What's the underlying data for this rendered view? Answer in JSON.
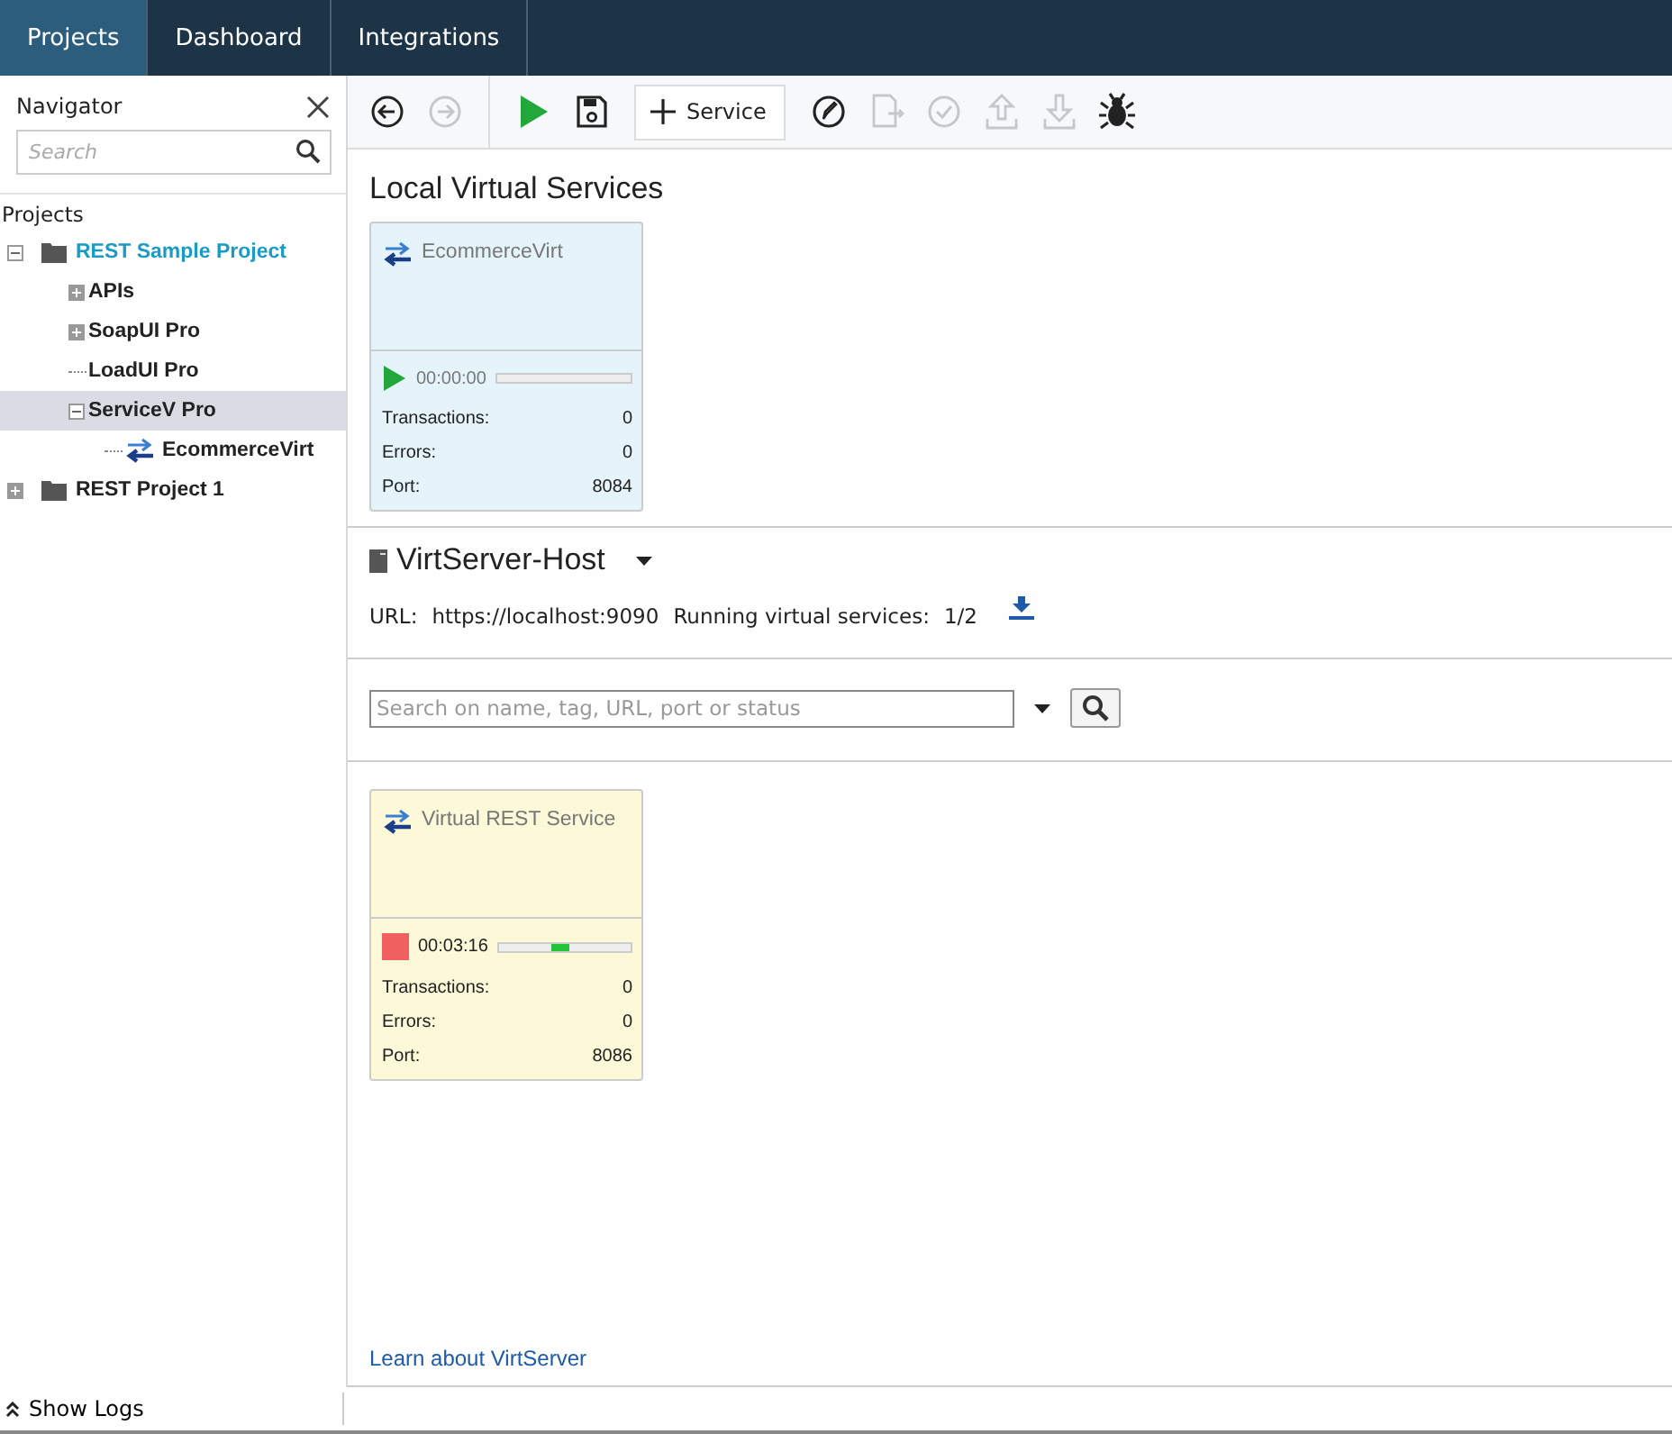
{
  "tabs": [
    {
      "label": "Projects",
      "selected": true
    },
    {
      "label": "Dashboard",
      "selected": false
    },
    {
      "label": "Integrations",
      "selected": false
    }
  ],
  "navigator": {
    "title": "Navigator",
    "search_placeholder": "Search",
    "section": "Projects",
    "tree": [
      {
        "label": "REST Sample Project",
        "kind": "project",
        "expanded": true,
        "active": true,
        "selected": false,
        "children": [
          {
            "label": "APIs",
            "expanded": false,
            "active": false,
            "selected": false
          },
          {
            "label": "SoapUI Pro",
            "expanded": false,
            "active": false,
            "selected": false
          },
          {
            "label": "LoadUI Pro",
            "active": false,
            "selected": false
          },
          {
            "label": "ServiceV Pro",
            "expanded": true,
            "active": false,
            "selected": true,
            "children": [
              {
                "label": "EcommerceVirt",
                "kind": "virt",
                "active": false,
                "selected": false
              }
            ]
          }
        ]
      },
      {
        "label": "REST Project 1",
        "kind": "project",
        "expanded": false,
        "active": false,
        "selected": false
      }
    ]
  },
  "toolbar": [
    {
      "kind": "back",
      "disabled": false
    },
    {
      "kind": "forward",
      "disabled": true
    },
    {
      "kind": "sep"
    },
    {
      "kind": "run",
      "disabled": false
    },
    {
      "kind": "save",
      "disabled": false
    },
    {
      "kind": "add",
      "label": "Service",
      "disabled": false
    },
    {
      "kind": "edit",
      "disabled": false
    },
    {
      "kind": "export",
      "disabled": true
    },
    {
      "kind": "check",
      "disabled": true
    },
    {
      "kind": "upload",
      "disabled": true
    },
    {
      "kind": "download",
      "disabled": true
    },
    {
      "kind": "bug",
      "disabled": false
    }
  ],
  "local": {
    "title": "Local Virtual Services",
    "cards": [
      {
        "name": "EcommerceVirt",
        "running": false,
        "time": "00:00:00",
        "stats": [
          {
            "label": "Transactions:",
            "value": "0"
          },
          {
            "label": "Errors:",
            "value": "0"
          },
          {
            "label": "Port:",
            "value": "8084"
          }
        ]
      }
    ]
  },
  "server": {
    "title": "VirtServer-Host",
    "url_label": "URL:",
    "url": "https://localhost:9090",
    "running_label": "Running virtual services:",
    "running": "1/2",
    "search_placeholder": "Search on name, tag, URL, port or status",
    "cards": [
      {
        "name": "Virtual REST Service",
        "running": true,
        "time": "00:03:16",
        "stats": [
          {
            "label": "Transactions:",
            "value": "0"
          },
          {
            "label": "Errors:",
            "value": "0"
          },
          {
            "label": "Port:",
            "value": "8086"
          }
        ]
      }
    ],
    "learn_link": "Learn about VirtServer"
  },
  "status_bar": {
    "show_logs": "Show Logs"
  }
}
